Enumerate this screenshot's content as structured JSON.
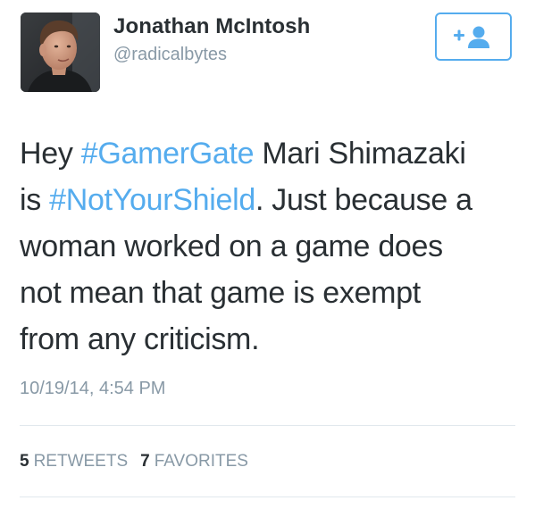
{
  "user": {
    "display_name": "Jonathan McIntosh",
    "handle": "@radicalbytes",
    "avatar_icon": "profile-photo"
  },
  "follow_button": {
    "icon": "follow-user-icon",
    "color": "#55acee"
  },
  "tweet": {
    "lines": [
      [
        {
          "text": "Hey ",
          "type": "text"
        },
        {
          "text": "#GamerGate",
          "type": "hashtag"
        },
        {
          "text": " Mari Shimazaki",
          "type": "text"
        }
      ],
      [
        {
          "text": "is ",
          "type": "text"
        },
        {
          "text": "#NotYourShield",
          "type": "hashtag"
        },
        {
          "text": ". Just because a",
          "type": "text"
        }
      ],
      [
        {
          "text": "woman worked on a game does",
          "type": "text"
        }
      ],
      [
        {
          "text": "not mean that game is exempt",
          "type": "text"
        }
      ],
      [
        {
          "text": "from any criticism.",
          "type": "text"
        }
      ]
    ],
    "timestamp": "10/19/14, 4:54 PM"
  },
  "stats": {
    "retweets_count": "5",
    "retweets_label": "RETWEETS",
    "favorites_count": "7",
    "favorites_label": "FAVORITES"
  },
  "colors": {
    "link": "#55acee",
    "text": "#292f33",
    "muted": "#8899a6",
    "divider": "#e1e8ed"
  }
}
